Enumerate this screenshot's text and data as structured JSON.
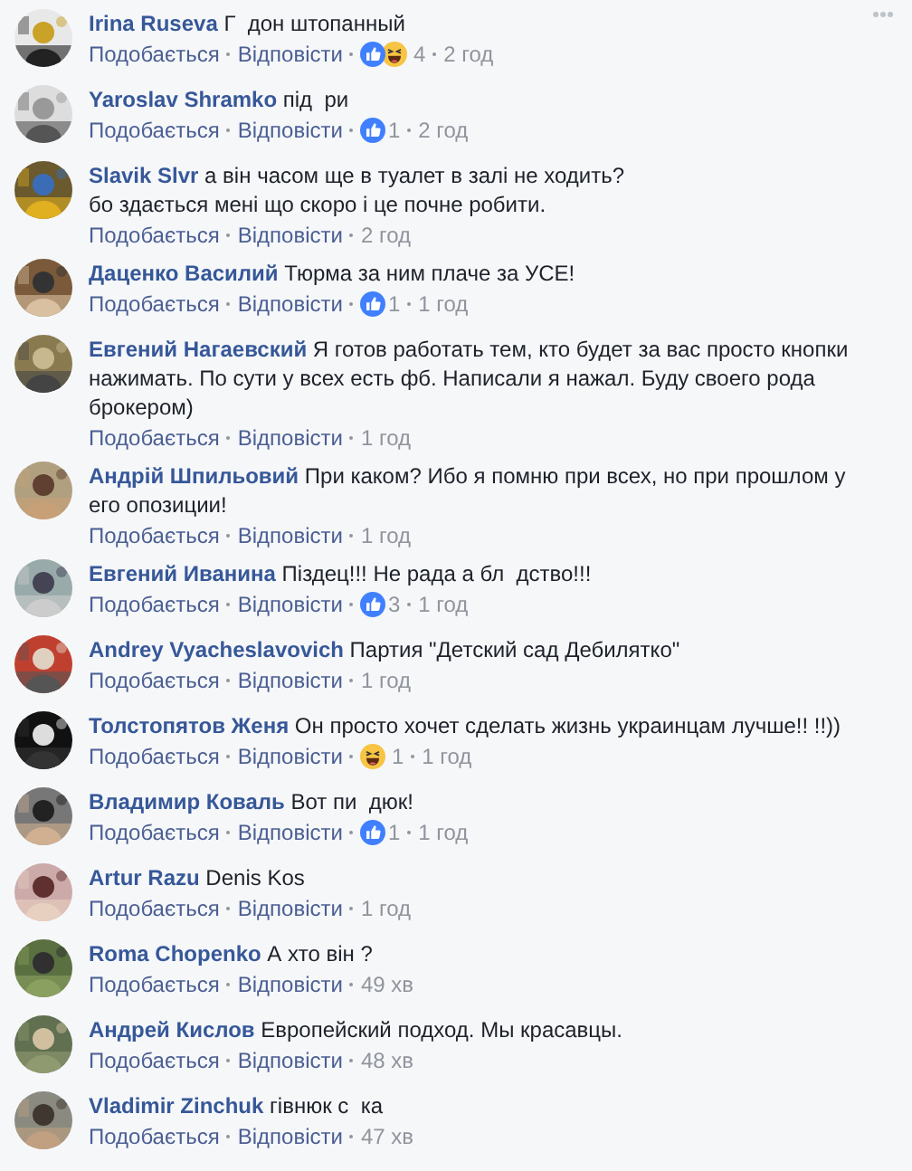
{
  "comments": [
    {
      "author": "Irina Ruseva",
      "text": "Г  дон штопанный",
      "like": "Подобається",
      "reply": "Відповісти",
      "reactions": [
        {
          "kind": "like"
        },
        {
          "kind": "haha"
        }
      ],
      "count": "4",
      "time": "2 год",
      "menu": true
    },
    {
      "author": "Yaroslav Shramko",
      "text": "під  ри",
      "like": "Подобається",
      "reply": "Відповісти",
      "reactions": [
        {
          "kind": "like"
        }
      ],
      "count": "1",
      "time": "2 год"
    },
    {
      "author": "Slavik Slvr",
      "text": "а він часом ще в туалет в залі не ходить?\nбо здається мені що скоро і це почне робити.",
      "like": "Подобається",
      "reply": "Відповісти",
      "time": "2 год"
    },
    {
      "author": "Даценко Василий",
      "text": "Тюрма за ним плаче за УСЕ!",
      "like": "Подобається",
      "reply": "Відповісти",
      "reactions": [
        {
          "kind": "like"
        }
      ],
      "count": "1",
      "time": "1 год"
    },
    {
      "author": "Евгений Нагаевский",
      "text": "Я готов работать тем, кто будет за вас просто кнопки нажимать. По сути у всех есть фб. Написали я нажал. Буду своего рода брокером)",
      "like": "Подобається",
      "reply": "Відповісти",
      "time": "1 год"
    },
    {
      "author": "Андрій Шпильовий",
      "text": "При каком? Ибо я помню при всех, но при прошлом у его опозиции!",
      "like": "Подобається",
      "reply": "Відповісти",
      "time": "1 год"
    },
    {
      "author": "Евгений Иванина",
      "text": "Піздец!!! Не рада а бл  дство!!!",
      "like": "Подобається",
      "reply": "Відповісти",
      "reactions": [
        {
          "kind": "like"
        }
      ],
      "count": "3",
      "time": "1 год"
    },
    {
      "author": "Andrey Vyacheslavovich",
      "text": "Партия \"Детский сад Дебилятко\"",
      "like": "Подобається",
      "reply": "Відповісти",
      "time": "1 год"
    },
    {
      "author": "Толстопятов Женя",
      "text": "Он просто хочет сделать жизнь украинцам лучше!! !!))",
      "like": "Подобається",
      "reply": "Відповісти",
      "reactions": [
        {
          "kind": "haha"
        }
      ],
      "count": "1",
      "time": "1 год"
    },
    {
      "author": "Владимир Коваль",
      "text": "Вот пи  дюк!",
      "like": "Подобається",
      "reply": "Відповісти",
      "reactions": [
        {
          "kind": "like"
        }
      ],
      "count": "1",
      "time": "1 год"
    },
    {
      "author": "Artur Razu",
      "text": "Denis Kos",
      "like": "Подобається",
      "reply": "Відповісти",
      "time": "1 год"
    },
    {
      "author": "Roma Chopenko",
      "text": "А хто він ?",
      "like": "Подобається",
      "reply": "Відповісти",
      "time": "49 хв"
    },
    {
      "author": "Андрей Кислов",
      "text": "Европейский подход. Мы красавцы.",
      "like": "Подобається",
      "reply": "Відповісти",
      "time": "48 хв"
    },
    {
      "author": "Vladimir Zinchuk",
      "text": "гівнюк с  ка",
      "like": "Подобається",
      "reply": "Відповісти",
      "time": "47 хв"
    }
  ]
}
